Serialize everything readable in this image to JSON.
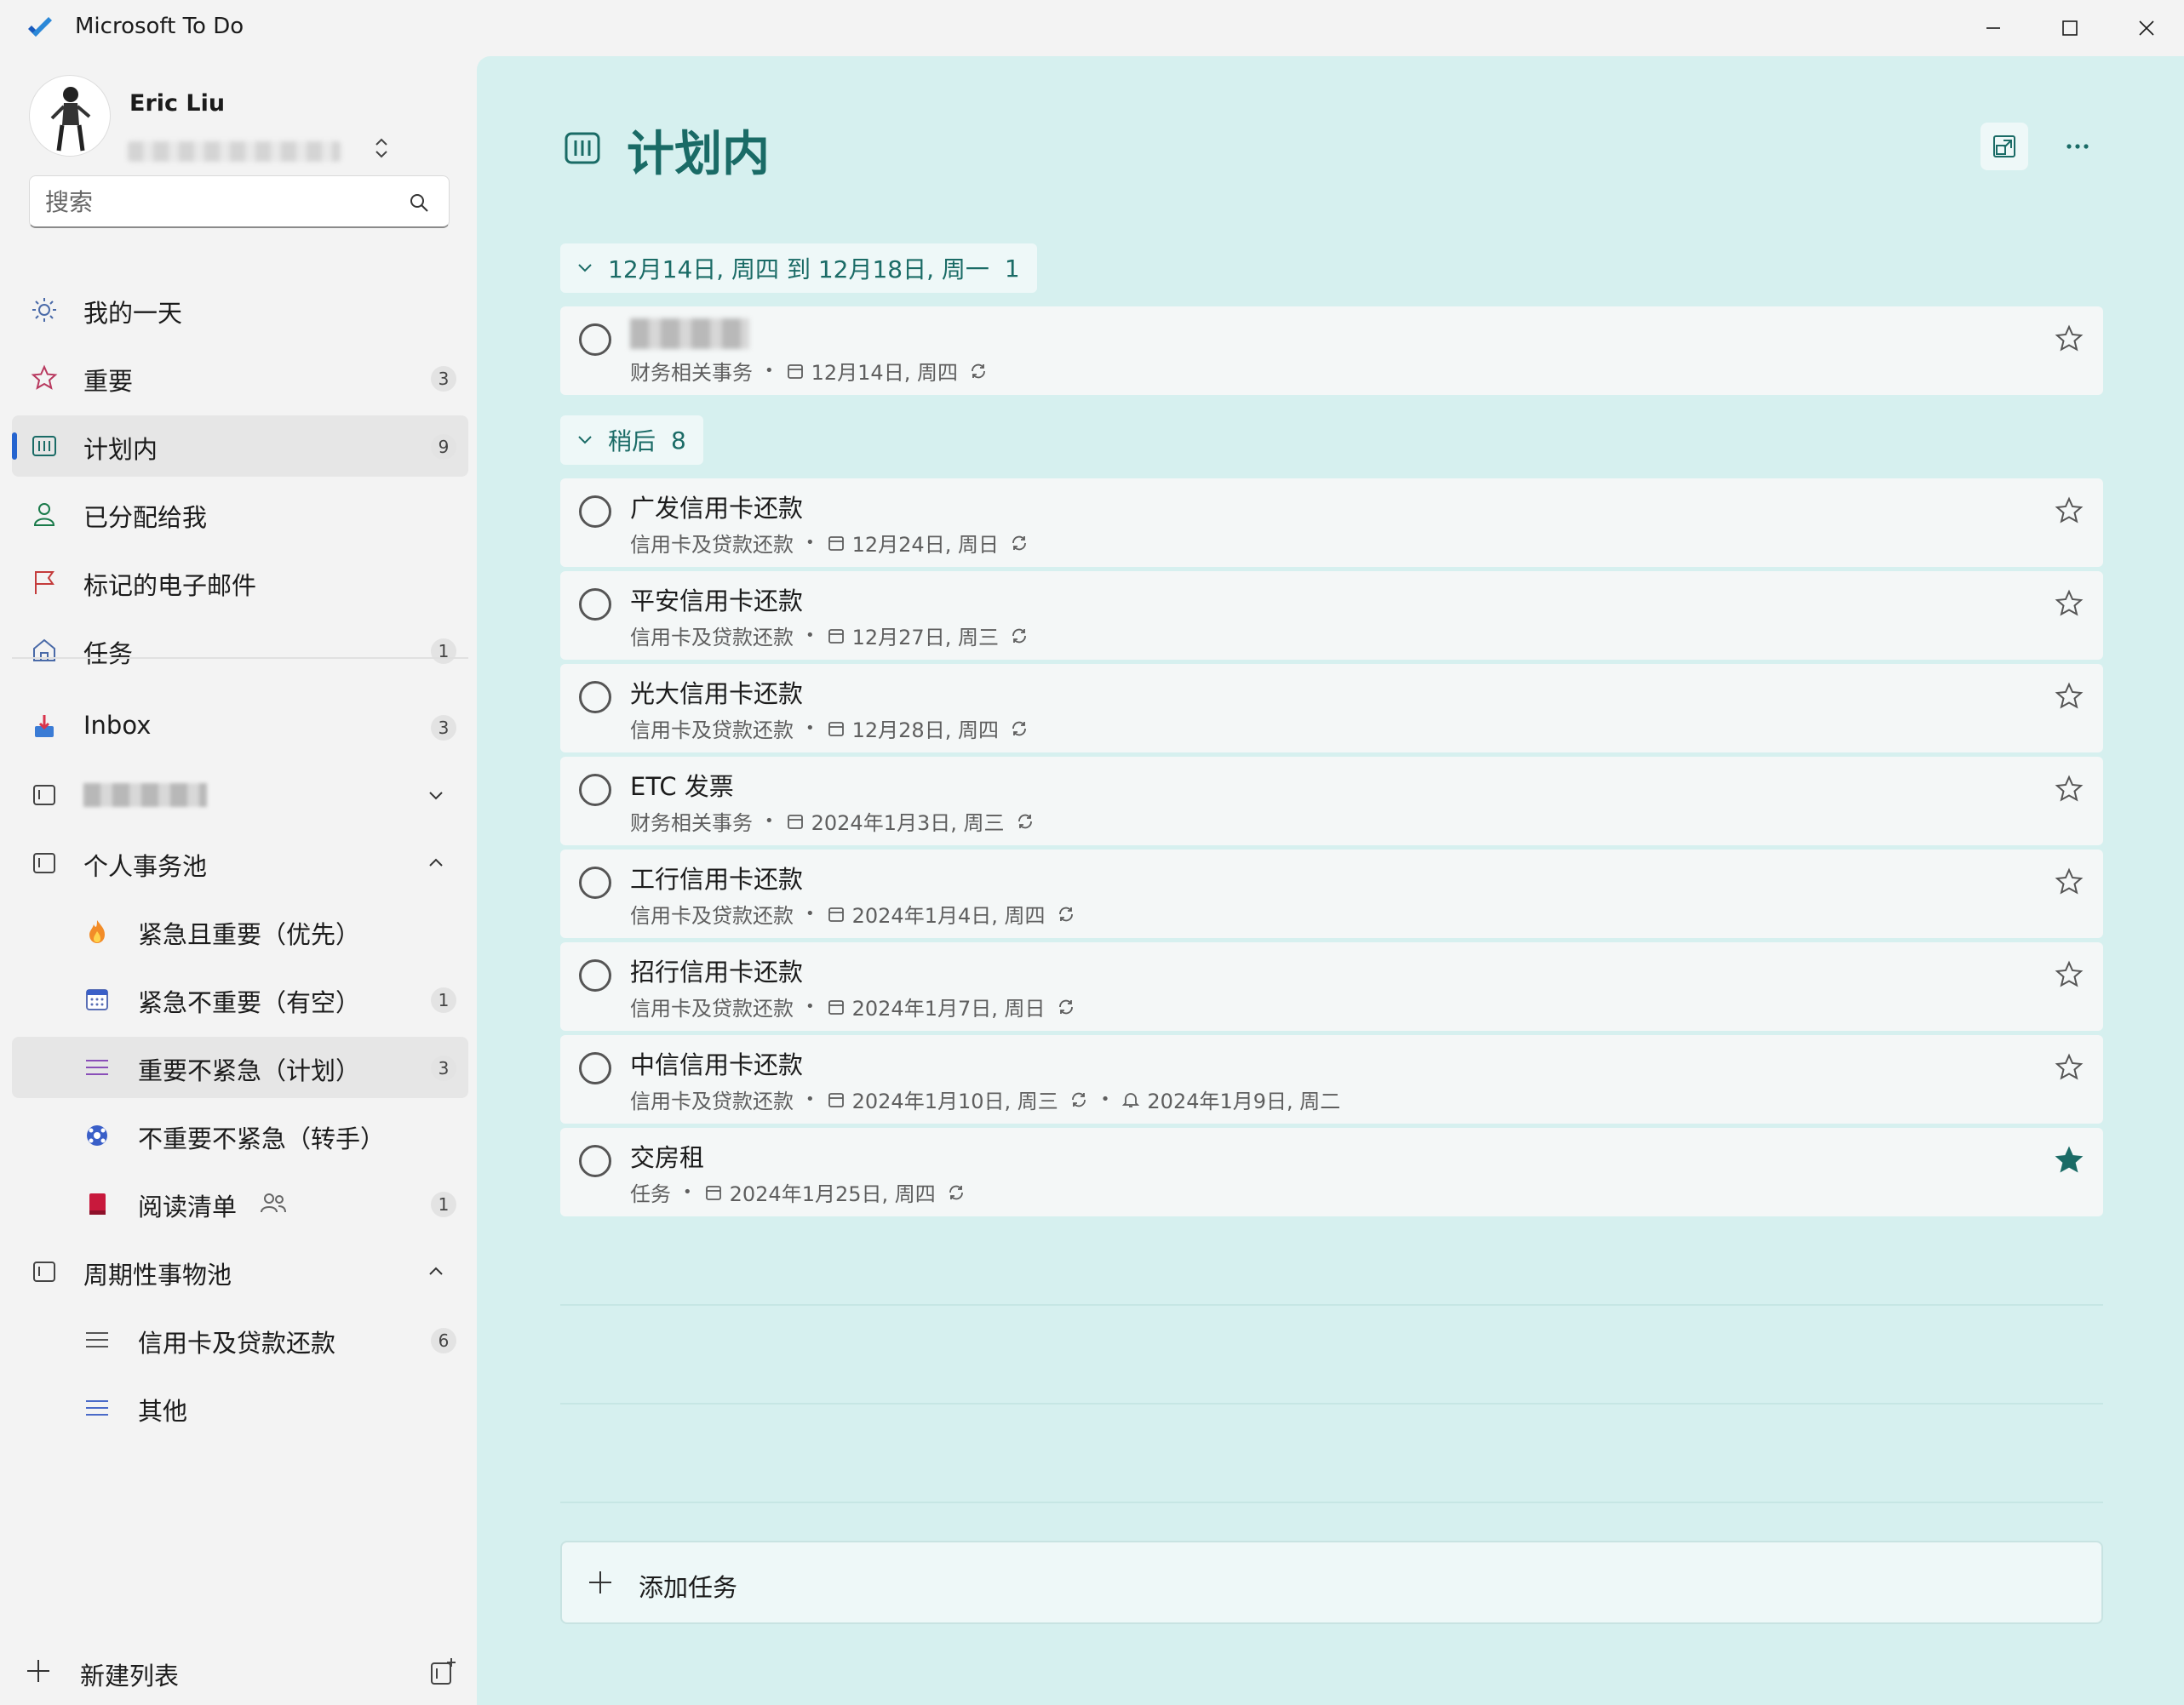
{
  "window": {
    "title": "Microsoft To Do"
  },
  "profile": {
    "name": "Eric Liu"
  },
  "search": {
    "placeholder": "搜索"
  },
  "nav": {
    "my_day": "我的一天",
    "important": {
      "label": "重要",
      "count": "3"
    },
    "planned": {
      "label": "计划内",
      "count": "9"
    },
    "assigned": "已分配给我",
    "flagged": "标记的电子邮件",
    "tasks": {
      "label": "任务",
      "count": "1"
    },
    "inbox": {
      "label": "Inbox",
      "count": "3"
    }
  },
  "groups": {
    "personal": {
      "label": "个人事务池",
      "lists": [
        {
          "label": "紧急且重要（优先）",
          "count": ""
        },
        {
          "label": "紧急不重要（有空）",
          "count": "1"
        },
        {
          "label": "重要不紧急（计划）",
          "count": "3"
        },
        {
          "label": "不重要不紧急（转手）",
          "count": ""
        },
        {
          "label": "阅读清单",
          "count": "1"
        }
      ]
    },
    "periodic": {
      "label": "周期性事物池",
      "lists": [
        {
          "label": "信用卡及贷款还款",
          "count": "6"
        },
        {
          "label": "其他",
          "count": ""
        }
      ]
    }
  },
  "new_list": "新建列表",
  "main": {
    "title": "计划内",
    "group1": {
      "label": "12月14日, 周四 到 12月18日, 周一",
      "count": "1"
    },
    "group2": {
      "label": "稍后",
      "count": "8"
    },
    "tasks": [
      {
        "title": "",
        "list": "财务相关事务",
        "due": "12月14日, 周四"
      },
      {
        "title": "广发信用卡还款",
        "list": "信用卡及贷款还款",
        "due": "12月24日, 周日"
      },
      {
        "title": "平安信用卡还款",
        "list": "信用卡及贷款还款",
        "due": "12月27日, 周三"
      },
      {
        "title": "光大信用卡还款",
        "list": "信用卡及贷款还款",
        "due": "12月28日, 周四"
      },
      {
        "title": "ETC 发票",
        "list": "财务相关事务",
        "due": "2024年1月3日, 周三"
      },
      {
        "title": "工行信用卡还款",
        "list": "信用卡及贷款还款",
        "due": "2024年1月4日, 周四"
      },
      {
        "title": "招行信用卡还款",
        "list": "信用卡及贷款还款",
        "due": "2024年1月7日, 周日"
      },
      {
        "title": "中信信用卡还款",
        "list": "信用卡及贷款还款",
        "due": "2024年1月10日, 周三",
        "reminder": "2024年1月9日, 周二"
      },
      {
        "title": "交房租",
        "list": "任务",
        "due": "2024年1月25日, 周四",
        "starred": true
      }
    ],
    "add_task": "添加任务"
  },
  "colors": {
    "accent": "#1a6b66",
    "main_bg": "#d6f0ef",
    "sidebar_bg": "#f3f3f3",
    "active_indicator": "#2564cf",
    "star_filled": "#1a6b66"
  }
}
